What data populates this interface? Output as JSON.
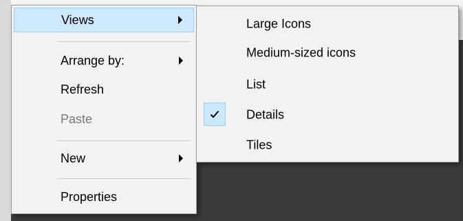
{
  "context_menu": {
    "items": [
      {
        "label": "Views",
        "has_submenu": true,
        "highlighted": true
      },
      {
        "label": "Arrange by:",
        "has_submenu": true
      },
      {
        "label": "Refresh"
      },
      {
        "label": "Paste",
        "disabled": true
      },
      {
        "label": "New",
        "has_submenu": true
      },
      {
        "label": "Properties"
      }
    ]
  },
  "views_submenu": {
    "items": [
      {
        "label": "Large Icons"
      },
      {
        "label": "Medium-sized icons"
      },
      {
        "label": "List"
      },
      {
        "label": "Details",
        "checked": true
      },
      {
        "label": "Tiles"
      }
    ]
  },
  "colors": {
    "highlight": "#cde8ff",
    "highlight_border": "#99d1ff",
    "menu_bg": "#f2f2f2",
    "disabled_text": "#7a7a7a",
    "dark_background": "#3b3b3b"
  }
}
